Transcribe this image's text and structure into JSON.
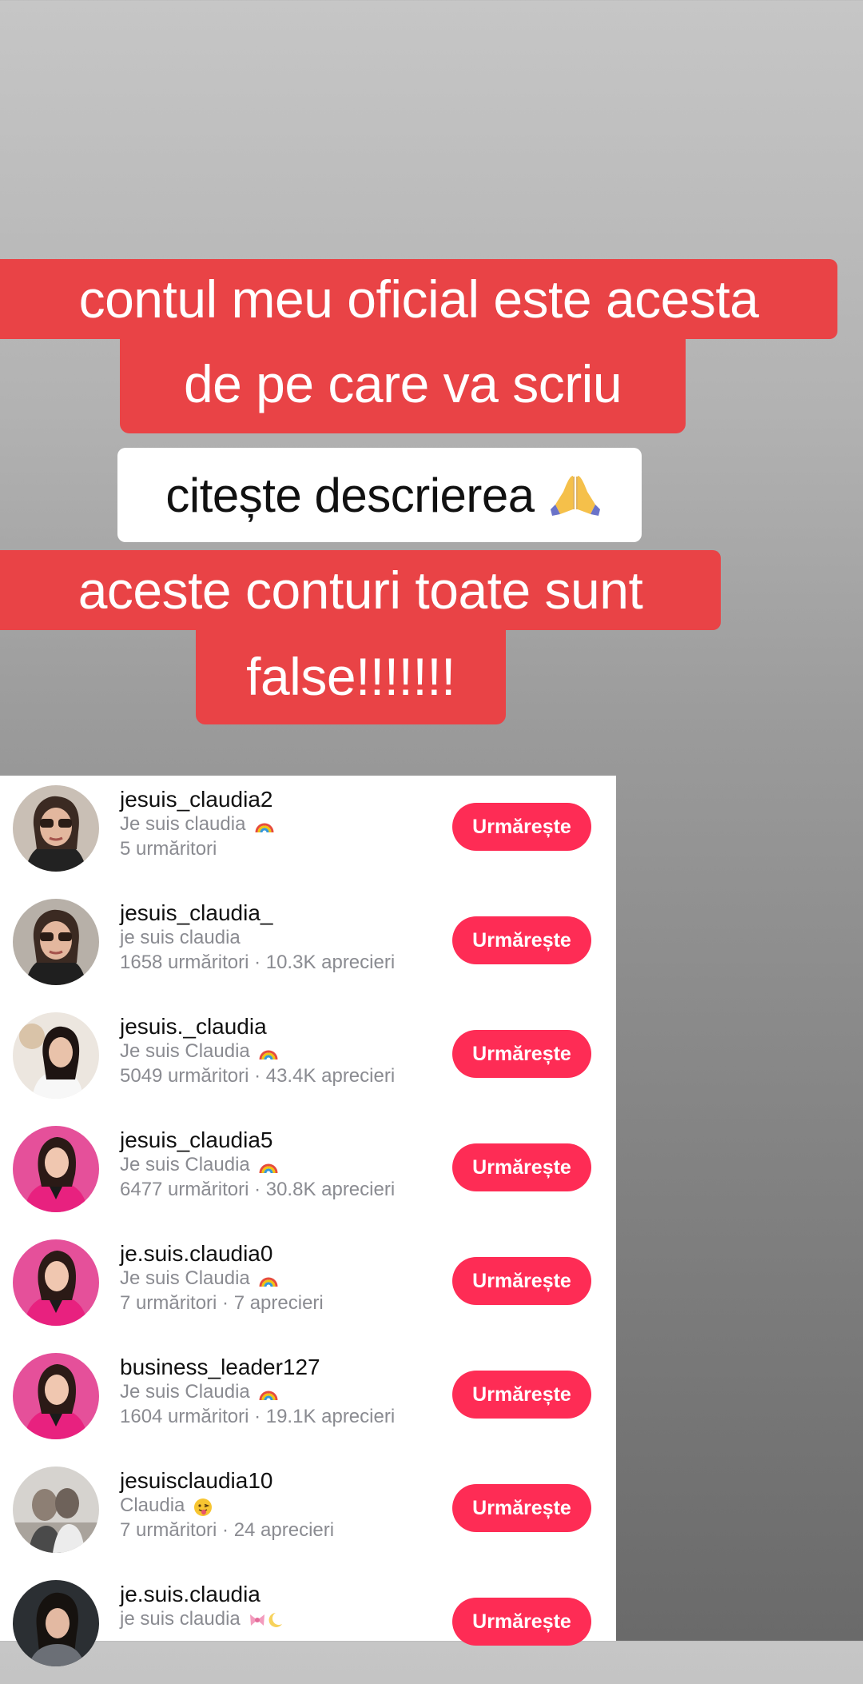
{
  "captions": {
    "line1": "contul meu oficial este acesta",
    "line2": "de pe care va scriu",
    "line3": "citește descrierea",
    "line4": "aceste conturi toate sunt",
    "line5": "false!!!!!!!"
  },
  "colors": {
    "caption_red": "#e94346",
    "follow_button": "#fe2c55",
    "secondary_text": "#8a8b91"
  },
  "accounts": [
    {
      "username": "jesuis_claudia2",
      "nickname": "Je suis claudia",
      "emoji": "rainbow-icon",
      "stats": "5 urmăritori",
      "button": "Urmărește"
    },
    {
      "username": "jesuis_claudia_",
      "nickname": "je suis claudia",
      "emoji": "",
      "stats": "1658 urmăritori · 10.3K aprecieri",
      "button": "Urmărește"
    },
    {
      "username": "jesuis._claudia",
      "nickname": "Je suis Claudia",
      "emoji": "rainbow-icon",
      "stats": "5049 urmăritori · 43.4K aprecieri",
      "button": "Urmărește"
    },
    {
      "username": "jesuis_claudia5",
      "nickname": "Je suis Claudia",
      "emoji": "rainbow-icon",
      "stats": "6477 urmăritori · 30.8K aprecieri",
      "button": "Urmărește"
    },
    {
      "username": "je.suis.claudia0",
      "nickname": "Je suis Claudia",
      "emoji": "rainbow-icon",
      "stats": "7 urmăritori · 7 aprecieri",
      "button": "Urmărește"
    },
    {
      "username": "business_leader127",
      "nickname": "Je suis Claudia",
      "emoji": "rainbow-icon",
      "stats": "1604 urmăritori · 19.1K aprecieri",
      "button": "Urmărește"
    },
    {
      "username": "jesuisclaudia10",
      "nickname": "Claudia",
      "emoji": "tongue-face-icon",
      "stats": "7 urmăritori · 24 aprecieri",
      "button": "Urmărește"
    },
    {
      "username": "je.suis.claudia",
      "nickname": "je suis claudia",
      "emoji": "ribbon-moon-icon",
      "stats": "",
      "button": "Urmărește"
    }
  ]
}
